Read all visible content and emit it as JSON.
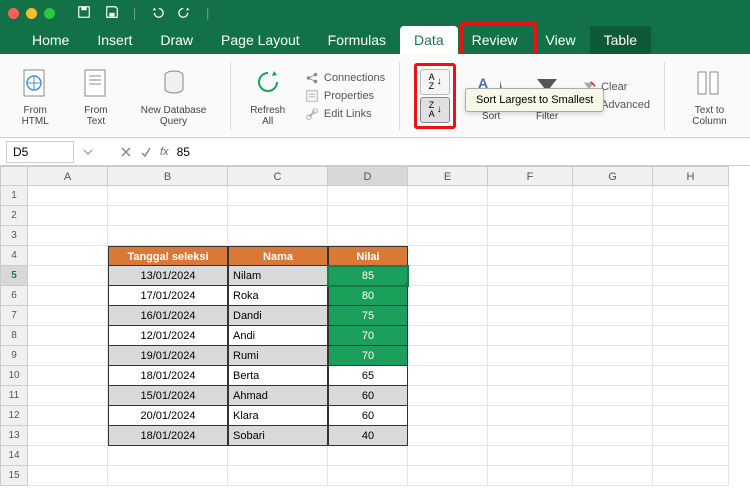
{
  "tabs": [
    "Home",
    "Insert",
    "Draw",
    "Page Layout",
    "Formulas",
    "Data",
    "Review",
    "View",
    "Table"
  ],
  "active_tab": "Data",
  "ribbon": {
    "from_html": "From\nHTML",
    "from_text": "From\nText",
    "new_db": "New Database\nQuery",
    "refresh": "Refresh\nAll",
    "connections": "Connections",
    "properties": "Properties",
    "edit_links": "Edit Links",
    "sort": "Sort",
    "filter": "Filter",
    "clear": "Clear",
    "advanced": "Advanced",
    "text_to_col": "Text to\nColumn"
  },
  "tooltip": "Sort Largest to Smallest",
  "formula_bar": {
    "cell_ref": "D5",
    "value": "85"
  },
  "columns": [
    "A",
    "B",
    "C",
    "D",
    "E",
    "F",
    "G",
    "H"
  ],
  "selected_col": "D",
  "selected_row": 5,
  "header_row": 4,
  "headers": {
    "B": "Tanggal seleksi",
    "C": "Nama",
    "D": "Nilai"
  },
  "rows": [
    {
      "n": 5,
      "B": "13/01/2024",
      "C": "Nilam",
      "D": "85",
      "grey": true,
      "green": true
    },
    {
      "n": 6,
      "B": "17/01/2024",
      "C": "Roka",
      "D": "80",
      "grey": false,
      "green": true
    },
    {
      "n": 7,
      "B": "16/01/2024",
      "C": "Dandi",
      "D": "75",
      "grey": true,
      "green": true
    },
    {
      "n": 8,
      "B": "12/01/2024",
      "C": "Andi",
      "D": "70",
      "grey": false,
      "green": true
    },
    {
      "n": 9,
      "B": "19/01/2024",
      "C": "Rumi",
      "D": "70",
      "grey": true,
      "green": true
    },
    {
      "n": 10,
      "B": "18/01/2024",
      "C": "Berta",
      "D": "65",
      "grey": false,
      "green": false
    },
    {
      "n": 11,
      "B": "15/01/2024",
      "C": "Ahmad",
      "D": "60",
      "grey": true,
      "green": false
    },
    {
      "n": 12,
      "B": "20/01/2024",
      "C": "Klara",
      "D": "60",
      "grey": false,
      "green": false
    },
    {
      "n": 13,
      "B": "18/01/2024",
      "C": "Sobari",
      "D": "40",
      "grey": true,
      "green": false
    }
  ],
  "visible_rows": 15
}
